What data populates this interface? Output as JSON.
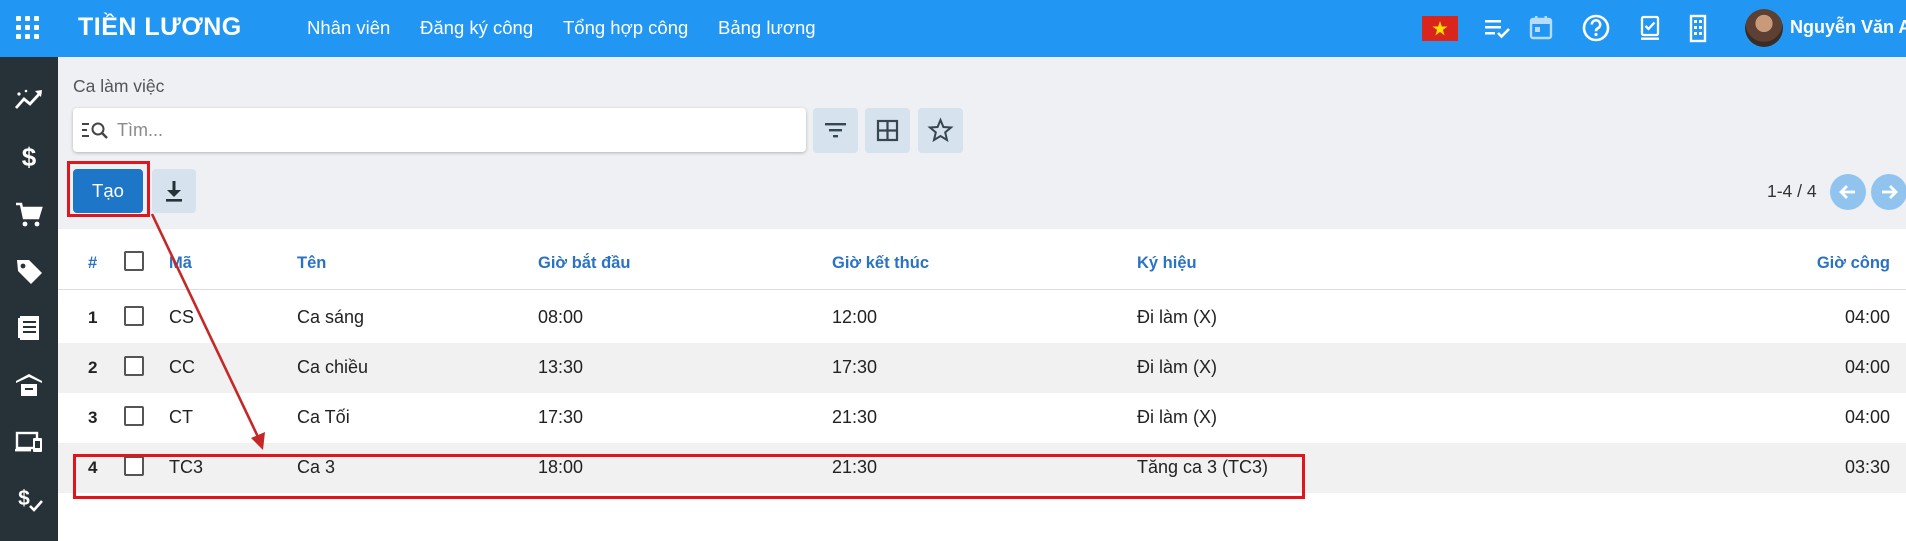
{
  "app": {
    "title": "TIỀN LƯƠNG"
  },
  "nav": [
    {
      "label": "Nhân viên"
    },
    {
      "label": "Đăng ký công"
    },
    {
      "label": "Tổng hợp công"
    },
    {
      "label": "Bảng lương"
    }
  ],
  "user": {
    "name": "Nguyễn Văn A"
  },
  "breadcrumb": "Ca làm việc",
  "search": {
    "placeholder": "Tìm..."
  },
  "buttons": {
    "create": "Tạo"
  },
  "pager": {
    "text": "1-4 / 4"
  },
  "table": {
    "columns": {
      "index": "#",
      "code": "Mã",
      "name": "Tên",
      "start": "Giờ bắt đầu",
      "end": "Giờ kết thúc",
      "symbol": "Ký hiệu",
      "hours": "Giờ công"
    },
    "rows": [
      {
        "index": "1",
        "code": "CS",
        "name": "Ca sáng",
        "start": "08:00",
        "end": "12:00",
        "symbol": "Đi làm (X)",
        "hours": "04:00"
      },
      {
        "index": "2",
        "code": "CC",
        "name": "Ca chiều",
        "start": "13:30",
        "end": "17:30",
        "symbol": "Đi làm (X)",
        "hours": "04:00"
      },
      {
        "index": "3",
        "code": "CT",
        "name": "Ca Tối",
        "start": "17:30",
        "end": "21:30",
        "symbol": "Đi làm (X)",
        "hours": "04:00"
      },
      {
        "index": "4",
        "code": "TC3",
        "name": "Ca 3",
        "start": "18:00",
        "end": "21:30",
        "symbol": "Tăng ca 3 (TC3)",
        "hours": "03:30"
      }
    ]
  },
  "colors": {
    "topbar": "#2196f3",
    "sidebar": "#263238",
    "primary_button": "#1e76c8",
    "header_text": "#2a72c4",
    "annotation": "#e0161c"
  }
}
